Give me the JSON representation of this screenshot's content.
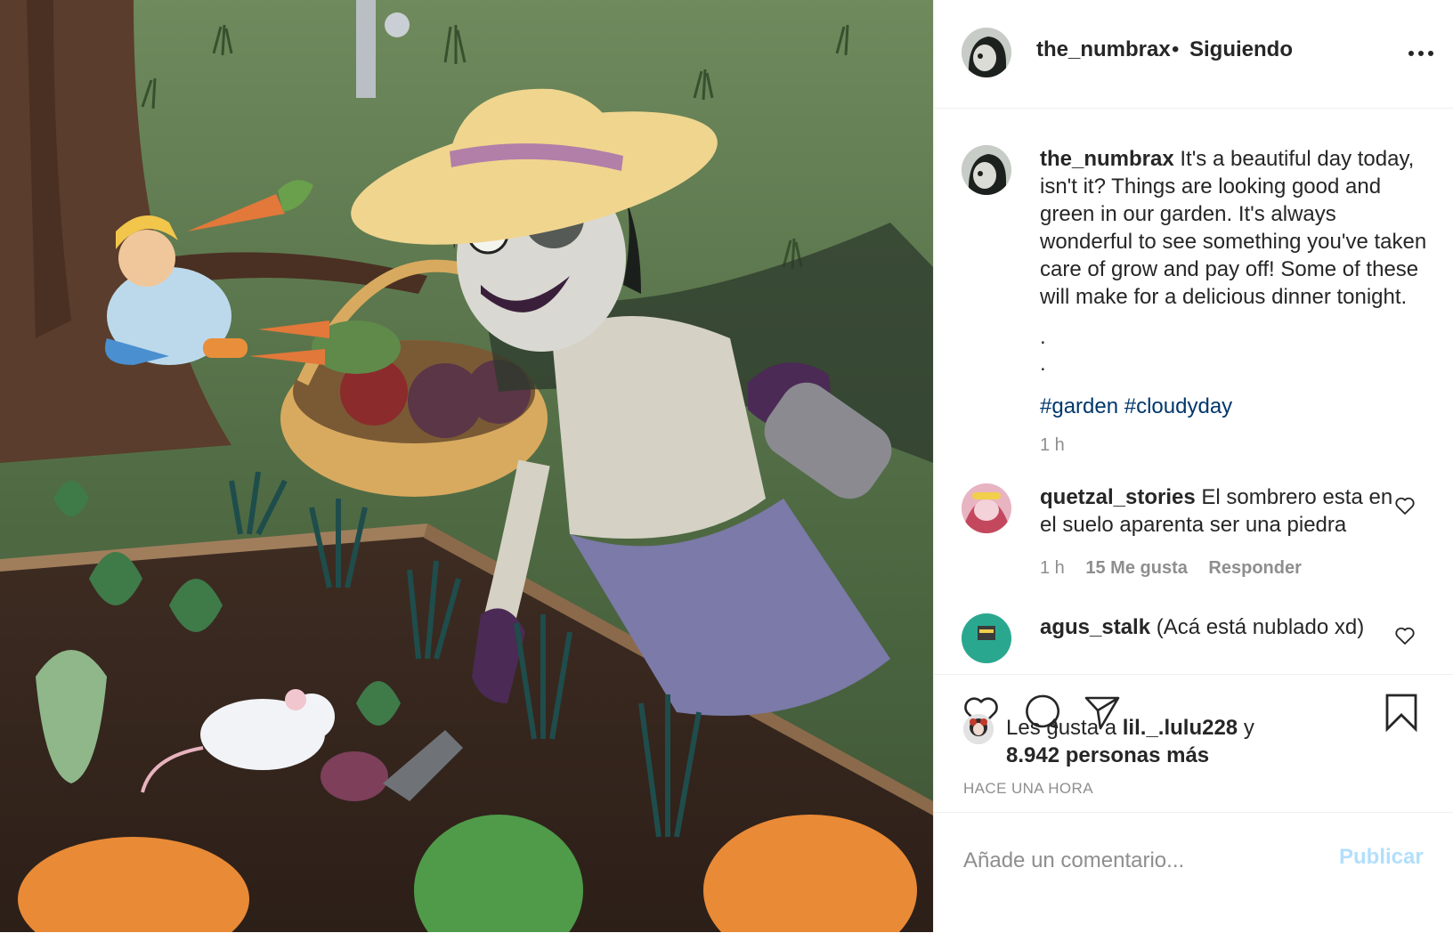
{
  "post": {
    "image_alt": "Ilustración de una jardinera cosechando verduras en un huerto",
    "colors": {
      "link": "#00376b",
      "secondary": "#8e8e8e",
      "publish_disabled": "#b2dffc",
      "border": "#efefef"
    }
  },
  "header": {
    "username": "the_numbrax",
    "separator": "•",
    "follow_status": "Siguiendo",
    "more_icon": "more-horizontal-icon"
  },
  "caption": {
    "username": "the_numbrax",
    "text": "It's a beautiful day today, isn't it? Things are looking good and green in our garden. It's always wonderful to see something you've taken care of grow and pay off! Some of these will make for a delicious dinner tonight.",
    "dot1": ".",
    "dot2": ".",
    "hashtags": [
      "#garden",
      "#cloudyday"
    ],
    "time": "1 h"
  },
  "comments": [
    {
      "username": "quetzal_stories",
      "text": "El sombrero esta en el suelo aparenta ser una piedra",
      "time": "1 h",
      "likes": "15 Me gusta",
      "reply": "Responder"
    },
    {
      "username": "agus_stalk",
      "text": "(Acá está nublado xd)"
    }
  ],
  "actions": {
    "icons": [
      "heart-icon",
      "comment-icon",
      "share-icon",
      "bookmark-icon"
    ]
  },
  "likes": {
    "prefix": "Les gusta a",
    "user": "lil._.lulu228",
    "joiner": "y",
    "others": "8.942 personas más"
  },
  "timestamp": "HACE UNA HORA",
  "add_comment": {
    "placeholder": "Añade un comentario...",
    "publish": "Publicar"
  }
}
